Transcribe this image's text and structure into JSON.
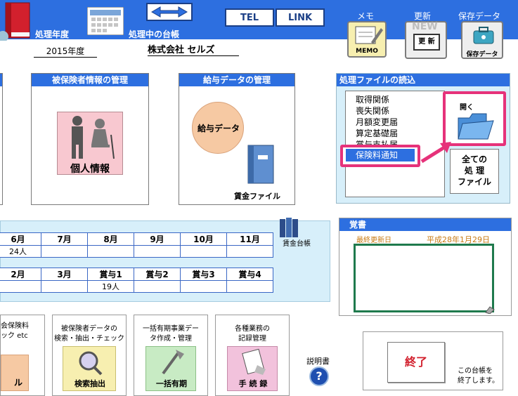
{
  "header": {
    "fiscal_year_label": "処理年度",
    "fiscal_year_value": "2015年度",
    "ledger_label": "処理中の台帳",
    "ledger_value": "株式会社 セルズ",
    "tel": "TEL",
    "link": "LINK",
    "memo_title": "メモ",
    "memo_button": "MEMO",
    "update_title": "更新",
    "update_new": "NEW",
    "update_button": "更 新",
    "save_title": "保存データ",
    "save_button": "保存データ"
  },
  "insured": {
    "title": "被保険者情報の管理",
    "button": "個人情報"
  },
  "salary": {
    "title": "給与データの管理",
    "salary_button": "給与データ",
    "wage_file": "賃金ファイル"
  },
  "files": {
    "title": "処理ファイルの読込",
    "items": [
      "取得関係",
      "喪失関係",
      "月額変更届",
      "算定基礎届",
      "賞与支払届",
      "保険料通知"
    ],
    "selected": "保険料通知",
    "open": "開く",
    "all_line1": "全ての",
    "all_line2": "処 理",
    "all_line3": "ファイル"
  },
  "ledger_wage": "賃金台帳",
  "months_row1": [
    "6月",
    "7月",
    "8月",
    "9月",
    "10月",
    "11月"
  ],
  "counts_row1": [
    "24人",
    "",
    "",
    "",
    "",
    ""
  ],
  "months_row2": [
    "2月",
    "3月",
    "賞与1",
    "賞与2",
    "賞与3",
    "賞与4"
  ],
  "counts_row2": [
    "",
    "",
    "19人",
    "",
    "",
    ""
  ],
  "memo": {
    "title": "覚書",
    "last_updated_label": "最終更新日",
    "last_updated_value": "平成28年1月29日"
  },
  "bottom": {
    "b1_line1": "会保険料",
    "b1_line2": "ック etc",
    "b1_label": "ル",
    "b2_line1": "被保険者データの",
    "b2_line2": "検索・抽出・チェック",
    "b2_label": "検索抽出",
    "b3_line1": "一括有期事業デー",
    "b3_line2": "タ作成・管理",
    "b3_label": "一括有期",
    "b4_line1": "各種業務の",
    "b4_line2": "記録管理",
    "b4_label": "手 続 録",
    "manual": "説明書",
    "exit": "終了",
    "exit_note1": "この台帳を",
    "exit_note2": "終了します。"
  },
  "colors": {
    "accent": "#2d6fe0",
    "highlight": "#e6327a",
    "memo_border": "#1f7a4d"
  }
}
